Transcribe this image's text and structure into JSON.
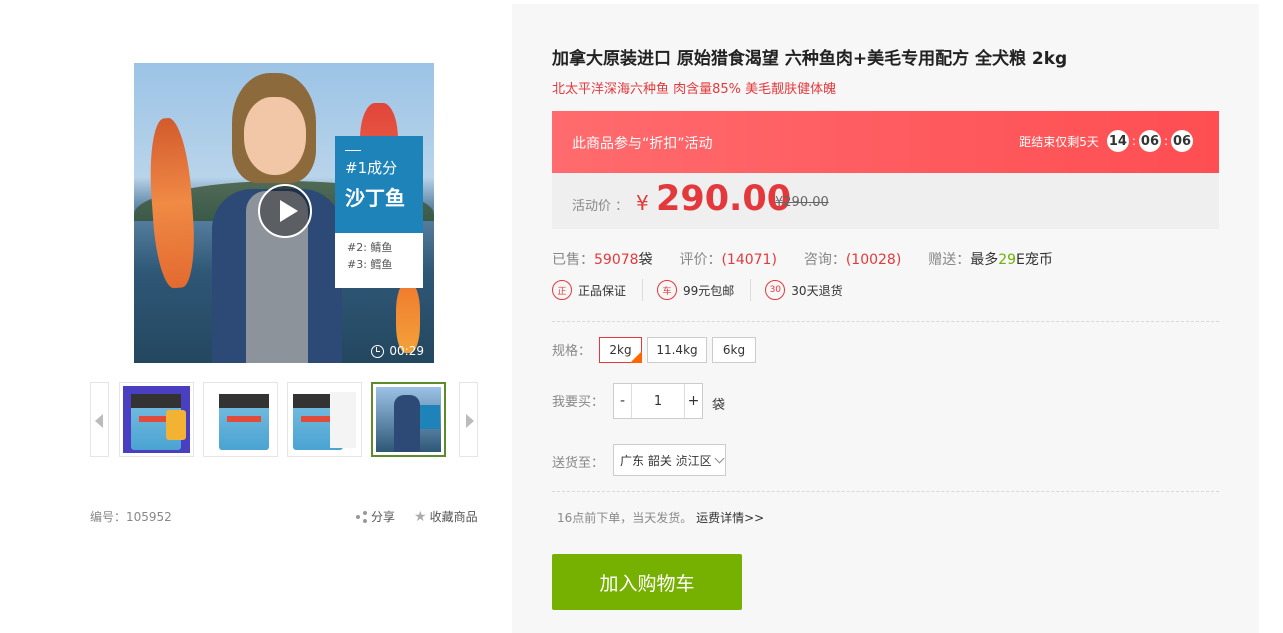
{
  "product": {
    "title": "加拿大原装进口 原始猎食渴望 六种鱼肉+美毛专用配方 全犬粮 2kg",
    "subtitle": "北太平洋深海六种鱼 肉含量85% 美毛靓肤健体魄"
  },
  "main_image": {
    "rank1": "#1成分",
    "ingredient1": "沙丁鱼",
    "rank2": "#2:  鲭鱼",
    "rank3": "#3:  鳕鱼",
    "video_duration": "00:29"
  },
  "meta": {
    "item_number": "编号：105952",
    "share_label": "分享",
    "favorite_label": "收藏商品"
  },
  "promo": {
    "text": "此商品参与“折扣”活动",
    "countdown_label": "距结束仅剩5天",
    "hours": "14",
    "minutes": "06",
    "seconds": "06"
  },
  "price": {
    "label": "活动价 ：",
    "currency": "¥",
    "current": "290.00",
    "original": "¥290.00"
  },
  "stats": {
    "sold_label": "已售：",
    "sold_value": "59078",
    "sold_unit": "袋",
    "reviews_label": "评价：",
    "reviews_value": "(14071)",
    "consult_label": "咨询：",
    "consult_value": "(10028)",
    "gift_label": "赠送：",
    "gift_prefix": "最多",
    "gift_value": "29",
    "gift_suffix": "E宠币"
  },
  "guarantees": [
    {
      "icon": "正",
      "label": "正品保证"
    },
    {
      "icon": "车",
      "label": "99元包邮"
    },
    {
      "icon": "30",
      "label": "30天退货"
    }
  ],
  "specs": {
    "label": "规格：",
    "options": [
      "2kg",
      "11.4kg",
      "6kg"
    ],
    "selected": "2kg"
  },
  "quantity": {
    "label": "我要买：",
    "minus": "-",
    "value": "1",
    "plus": "+",
    "unit": "袋"
  },
  "shipping": {
    "label": "送货至：",
    "region": "广东 韶关 浈江区",
    "note": "16点前下单，当天发货。",
    "link": "运费详情>>"
  },
  "cart_button": "加入购物车",
  "colors": {
    "accent_red": "#e4393c",
    "cart_green": "#76b000",
    "promo_red": "#fe4e52"
  }
}
